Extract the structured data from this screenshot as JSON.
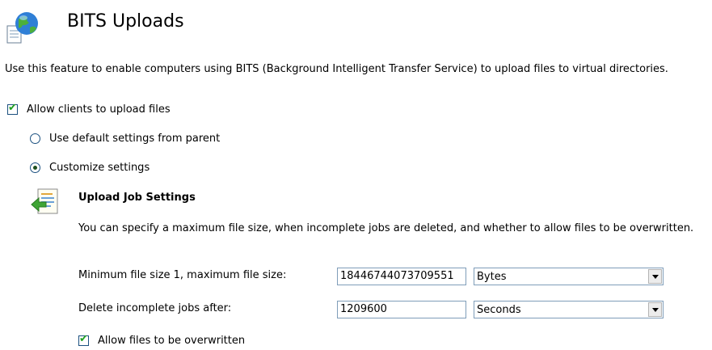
{
  "header": {
    "title": "BITS Uploads",
    "icon": "globe-document-icon"
  },
  "description": "Use this feature to enable computers using BITS (Background Intelligent Transfer Service) to upload files to virtual directories.",
  "allow_upload": {
    "label": "Allow clients to upload files",
    "checked": true
  },
  "settings_mode": {
    "options": [
      {
        "label": "Use default settings from parent",
        "selected": false
      },
      {
        "label": "Customize settings",
        "selected": true
      }
    ]
  },
  "upload_job": {
    "icon": "upload-document-icon",
    "title": "Upload Job Settings",
    "description": "You can specify a maximum file size, when incomplete jobs are deleted, and whether to allow files to be overwritten.",
    "max_size": {
      "label": "Minimum file size 1, maximum file size:",
      "value": "18446744073709551",
      "unit": "Bytes"
    },
    "delete_after": {
      "label": "Delete incomplete jobs after:",
      "value": "1209600",
      "unit": "Seconds"
    },
    "overwrite": {
      "label": "Allow files to be overwritten",
      "checked": true
    }
  }
}
